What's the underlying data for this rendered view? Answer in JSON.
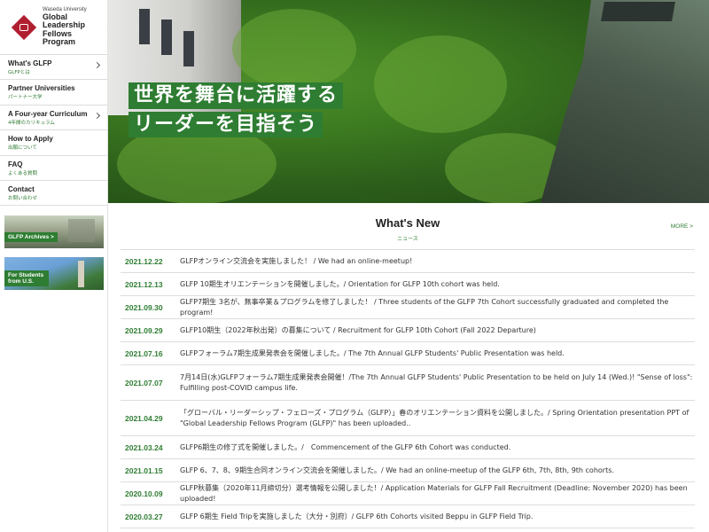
{
  "logo": {
    "small": "Waseda University",
    "lines": [
      "Global",
      "Leadership",
      "Fellows",
      "Program"
    ]
  },
  "nav": [
    {
      "en": "What's GLFP",
      "ja": "GLFPとは",
      "chevron": true
    },
    {
      "en": "Partner Universities",
      "ja": "パートナー大学",
      "chevron": false
    },
    {
      "en": "A Four-year Curriculum",
      "ja": "4年間のカリキュラム",
      "chevron": true
    },
    {
      "en": "How to Apply",
      "ja": "出願について",
      "chevron": false
    },
    {
      "en": "FAQ",
      "ja": "よくある質問",
      "chevron": false
    },
    {
      "en": "Contact",
      "ja": "お問い合わせ",
      "chevron": false
    }
  ],
  "banners": [
    {
      "label": "GLFP Archives >"
    },
    {
      "label": "For Students from U.S."
    }
  ],
  "hero": {
    "line1": "世界を舞台に活躍する",
    "line2": "リーダーを目指そう",
    "accent": "#2e7d32"
  },
  "news": {
    "title": "What's New",
    "subtitle": "ニュース",
    "more": "MORE >",
    "items": [
      {
        "date": "2021.12.22",
        "text": "GLFPオンライン交流会を実施しました！ / We had an online-meetup!"
      },
      {
        "date": "2021.12.13",
        "text": "GLFP 10期生オリエンテーションを開催しました。/ Orientation for GLFP 10th cohort was held."
      },
      {
        "date": "2021.09.30",
        "text": "GLFP7期生 3名が、無事卒業＆プログラムを修了しました！ / Three students of the GLFP 7th Cohort successfully graduated and completed the program!"
      },
      {
        "date": "2021.09.29",
        "text": "GLFP10期生（2022年秋出発）の募集について / Recruitment for GLFP 10th Cohort (Fall 2022 Departure)"
      },
      {
        "date": "2021.07.16",
        "text": "GLFPフォーラム7期生成果発表会を開催しました。/ The 7th Annual GLFP Students' Public Presentation was held."
      },
      {
        "date": "2021.07.07",
        "text": "7月14日(水)GLFPフォーラム7期生成果発表会開催！/The 7th Annual GLFP Students' Public Presentation to be held on July 14 (Wed.)! \"Sense of loss\": Fulfilling post-COVID campus life."
      },
      {
        "date": "2021.04.29",
        "text": "「グローバル・リーダーシップ・フェローズ・プログラム（GLFP）」春のオリエンテーション資料を公開しました。/ Spring Orientation presentation PPT of \"Global Leadership Fellows Program (GLFP)\" has been uploaded.."
      },
      {
        "date": "2021.03.24",
        "text": "GLFP6期生の修了式を開催しました。/　Commencement of the GLFP 6th Cohort was conducted."
      },
      {
        "date": "2021.01.15",
        "text": "GLFP 6、7、8、9期生合同オンライン交流会を開催しました。/ We had an online-meetup of the GLFP 6th, 7th, 8th, 9th cohorts."
      },
      {
        "date": "2020.10.09",
        "text": "GLFP秋募集（2020年11月締切分）選考情報を公開しました！/ Application Materials for GLFP Fall Recruitment (Deadline: November 2020) has been uploaded!"
      },
      {
        "date": "2020.03.27",
        "text": "GLFP 6期生 Field Tripを実施しました（大分・別府）/ GLFP 6th Cohorts visited Beppu in GLFP Field Trip."
      }
    ]
  }
}
